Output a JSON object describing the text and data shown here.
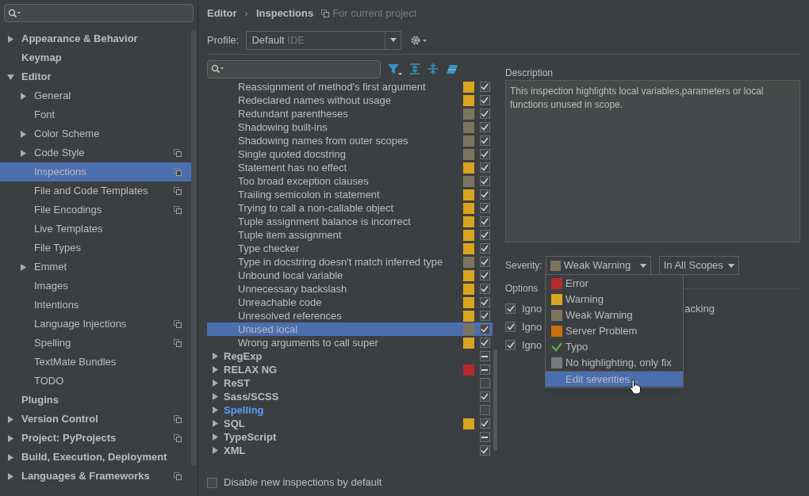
{
  "sidebar": {
    "items": [
      {
        "label": "Appearance & Behavior",
        "expanded": false,
        "has_children": true,
        "selected": false,
        "project": false
      },
      {
        "label": "Keymap",
        "has_children": false,
        "selected": false,
        "project": false
      },
      {
        "label": "Editor",
        "expanded": true,
        "has_children": true,
        "selected": false,
        "project": false,
        "children": [
          {
            "label": "General",
            "has_children": true,
            "expanded": false,
            "selected": false,
            "project": false
          },
          {
            "label": "Font",
            "has_children": false,
            "selected": false,
            "project": false
          },
          {
            "label": "Color Scheme",
            "has_children": true,
            "expanded": false,
            "selected": false,
            "project": false
          },
          {
            "label": "Code Style",
            "has_children": true,
            "expanded": false,
            "selected": false,
            "project": true
          },
          {
            "label": "Inspections",
            "has_children": false,
            "selected": true,
            "project": true
          },
          {
            "label": "File and Code Templates",
            "has_children": false,
            "selected": false,
            "project": true
          },
          {
            "label": "File Encodings",
            "has_children": false,
            "selected": false,
            "project": true
          },
          {
            "label": "Live Templates",
            "has_children": false,
            "selected": false,
            "project": false
          },
          {
            "label": "File Types",
            "has_children": false,
            "selected": false,
            "project": false
          },
          {
            "label": "Emmet",
            "has_children": true,
            "expanded": false,
            "selected": false,
            "project": false
          },
          {
            "label": "Images",
            "has_children": false,
            "selected": false,
            "project": false
          },
          {
            "label": "Intentions",
            "has_children": false,
            "selected": false,
            "project": false
          },
          {
            "label": "Language Injections",
            "has_children": false,
            "selected": false,
            "project": true
          },
          {
            "label": "Spelling",
            "has_children": false,
            "selected": false,
            "project": true
          },
          {
            "label": "TextMate Bundles",
            "has_children": false,
            "selected": false,
            "project": false
          },
          {
            "label": "TODO",
            "has_children": false,
            "selected": false,
            "project": false
          }
        ]
      },
      {
        "label": "Plugins",
        "has_children": false,
        "selected": false,
        "project": false
      },
      {
        "label": "Version Control",
        "expanded": false,
        "has_children": true,
        "selected": false,
        "project": true
      },
      {
        "label": "Project: PyProjects",
        "expanded": false,
        "has_children": true,
        "selected": false,
        "project": true
      },
      {
        "label": "Build, Execution, Deployment",
        "expanded": false,
        "has_children": true,
        "selected": false,
        "project": false
      },
      {
        "label": "Languages & Frameworks",
        "expanded": false,
        "has_children": true,
        "selected": false,
        "project": true
      }
    ]
  },
  "breadcrumb": [
    "Editor",
    "Inspections"
  ],
  "breadcrumb_separator": "›",
  "scope_note": "For current project",
  "profile": {
    "label": "Profile:",
    "value": "Default",
    "tag": "IDE"
  },
  "inspections": [
    {
      "kind": "item",
      "label": "Reassignment of method's first argument",
      "color": "#d9a520",
      "checked": true,
      "mixed": false,
      "selected": false
    },
    {
      "kind": "item",
      "label": "Redeclared names without usage",
      "color": "#d9a520",
      "checked": true,
      "mixed": false,
      "selected": false
    },
    {
      "kind": "item",
      "label": "Redundant parentheses",
      "color": "#7c7460",
      "checked": true,
      "mixed": false,
      "selected": false
    },
    {
      "kind": "item",
      "label": "Shadowing built-ins",
      "color": "#7c7460",
      "checked": true,
      "mixed": false,
      "selected": false
    },
    {
      "kind": "item",
      "label": "Shadowing names from outer scopes",
      "color": "#7c7460",
      "checked": true,
      "mixed": false,
      "selected": false
    },
    {
      "kind": "item",
      "label": "Single quoted docstring",
      "color": "#7c7460",
      "checked": true,
      "mixed": false,
      "selected": false
    },
    {
      "kind": "item",
      "label": "Statement has no effect",
      "color": "#d9a520",
      "checked": true,
      "mixed": false,
      "selected": false
    },
    {
      "kind": "item",
      "label": "Too broad exception clauses",
      "color": "#7c7460",
      "checked": true,
      "mixed": false,
      "selected": false
    },
    {
      "kind": "item",
      "label": "Trailing semicolon in statement",
      "color": "#d9a520",
      "checked": true,
      "mixed": false,
      "selected": false
    },
    {
      "kind": "item",
      "label": "Trying to call a non-callable object",
      "color": "#d9a520",
      "checked": true,
      "mixed": false,
      "selected": false
    },
    {
      "kind": "item",
      "label": "Tuple assignment balance is incorrect",
      "color": "#d9a520",
      "checked": true,
      "mixed": false,
      "selected": false
    },
    {
      "kind": "item",
      "label": "Tuple item assignment",
      "color": "#d9a520",
      "checked": true,
      "mixed": false,
      "selected": false
    },
    {
      "kind": "item",
      "label": "Type checker",
      "color": "#d9a520",
      "checked": true,
      "mixed": false,
      "selected": false
    },
    {
      "kind": "item",
      "label": "Type in docstring doesn't match inferred type",
      "color": "#7c7460",
      "checked": true,
      "mixed": false,
      "selected": false
    },
    {
      "kind": "item",
      "label": "Unbound local variable",
      "color": "#d9a520",
      "checked": true,
      "mixed": false,
      "selected": false
    },
    {
      "kind": "item",
      "label": "Unnecessary backslash",
      "color": "#d9a520",
      "checked": true,
      "mixed": false,
      "selected": false
    },
    {
      "kind": "item",
      "label": "Unreachable code",
      "color": "#d9a520",
      "checked": true,
      "mixed": false,
      "selected": false
    },
    {
      "kind": "item",
      "label": "Unresolved references",
      "color": "#d9a520",
      "checked": true,
      "mixed": false,
      "selected": false
    },
    {
      "kind": "item",
      "label": "Unused local",
      "color": "#7c7460",
      "checked": true,
      "mixed": false,
      "selected": true
    },
    {
      "kind": "item",
      "label": "Wrong arguments to call super",
      "color": "#d9a520",
      "checked": true,
      "mixed": false,
      "selected": false
    },
    {
      "kind": "group",
      "label": "RegExp",
      "checked": true,
      "mixed": true,
      "selected": false,
      "modified": false
    },
    {
      "kind": "group",
      "label": "RELAX NG",
      "color": "#b52a2a",
      "checked": true,
      "mixed": true,
      "selected": false,
      "modified": false
    },
    {
      "kind": "group",
      "label": "ReST",
      "checked": false,
      "selected": false,
      "modified": false
    },
    {
      "kind": "group",
      "label": "Sass/SCSS",
      "checked": true,
      "mixed": false,
      "selected": false,
      "modified": false
    },
    {
      "kind": "group",
      "label": "Spelling",
      "checked": false,
      "selected": false,
      "modified": true
    },
    {
      "kind": "group",
      "label": "SQL",
      "color": "#d9a520",
      "checked": true,
      "mixed": false,
      "selected": false,
      "modified": false
    },
    {
      "kind": "group",
      "label": "TypeScript",
      "checked": true,
      "mixed": true,
      "selected": false,
      "modified": false
    },
    {
      "kind": "group",
      "label": "XML",
      "checked": true,
      "mixed": false,
      "selected": false,
      "modified": false
    }
  ],
  "disable_new": {
    "label": "Disable new inspections by default",
    "checked": false
  },
  "description": {
    "title": "Description",
    "text": "This inspection highlights local variables,parameters or local functions unused in scope."
  },
  "severity": {
    "label": "Severity:",
    "value": "Weak Warning",
    "color": "#7c7460",
    "scope": "In All Scopes"
  },
  "options": {
    "title": "Options",
    "items": [
      {
        "text": "Igno",
        "tail": "acking",
        "checked": true
      },
      {
        "text": "Igno",
        "checked": true
      },
      {
        "text": "Igno",
        "checked": true
      }
    ]
  },
  "severity_menu": [
    {
      "kind": "severity",
      "label": "Error",
      "color": "#b52a2a",
      "selected": false
    },
    {
      "kind": "severity",
      "label": "Warning",
      "color": "#d9a520",
      "selected": false
    },
    {
      "kind": "severity",
      "label": "Weak Warning",
      "color": "#7c7460",
      "selected": false
    },
    {
      "kind": "severity",
      "label": "Server Problem",
      "color": "#c8700a",
      "selected": false
    },
    {
      "kind": "typo",
      "label": "Typo",
      "selected": false
    },
    {
      "kind": "severity",
      "label": "No highlighting, only fix",
      "color": "#7a7a7a",
      "selected": false
    },
    {
      "kind": "action",
      "label": "Edit severities...",
      "selected": true
    }
  ]
}
